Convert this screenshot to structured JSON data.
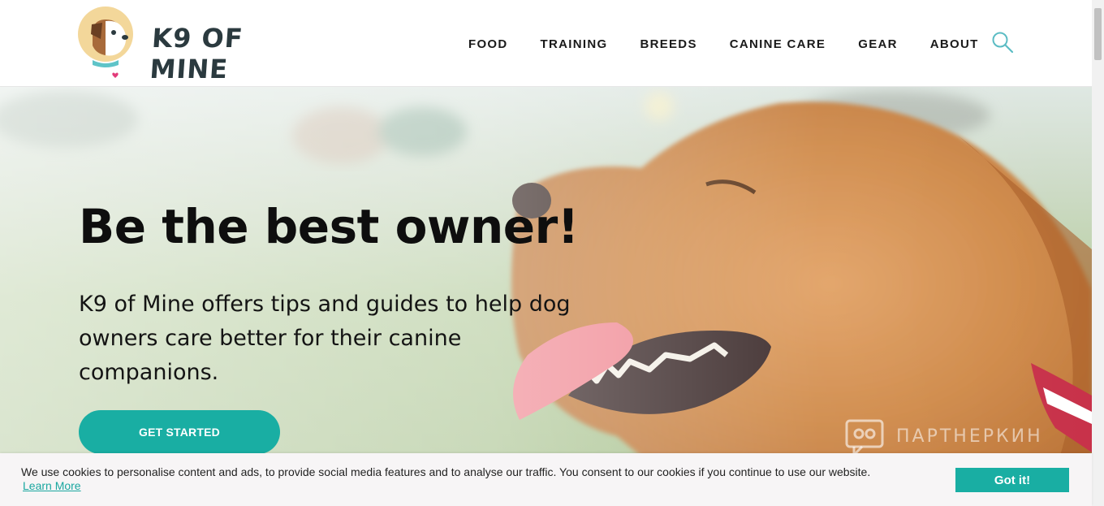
{
  "header": {
    "logo_text": "K9 OF MINE",
    "nav": [
      "FOOD",
      "TRAINING",
      "BREEDS",
      "CANINE CARE",
      "GEAR",
      "ABOUT"
    ]
  },
  "hero": {
    "title": "Be the best owner!",
    "subtitle": "K9 of Mine offers tips and guides to help dog owners care better for their canine companions.",
    "cta_label": "GET STARTED",
    "watermark": "ПАРТНЕРКИН"
  },
  "cookie": {
    "text": "We use cookies to personalise content and ads, to provide social media features and to analyse our traffic. You consent to our cookies if you continue to use our website.",
    "link": "Learn More",
    "button": "Got it!"
  },
  "colors": {
    "accent": "#19aea3",
    "logo_dark": "#2b3a3f",
    "logo_circle": "#f3d79a"
  },
  "icons": [
    "dog-logo-icon",
    "search-icon",
    "partnerkin-watermark-icon"
  ]
}
